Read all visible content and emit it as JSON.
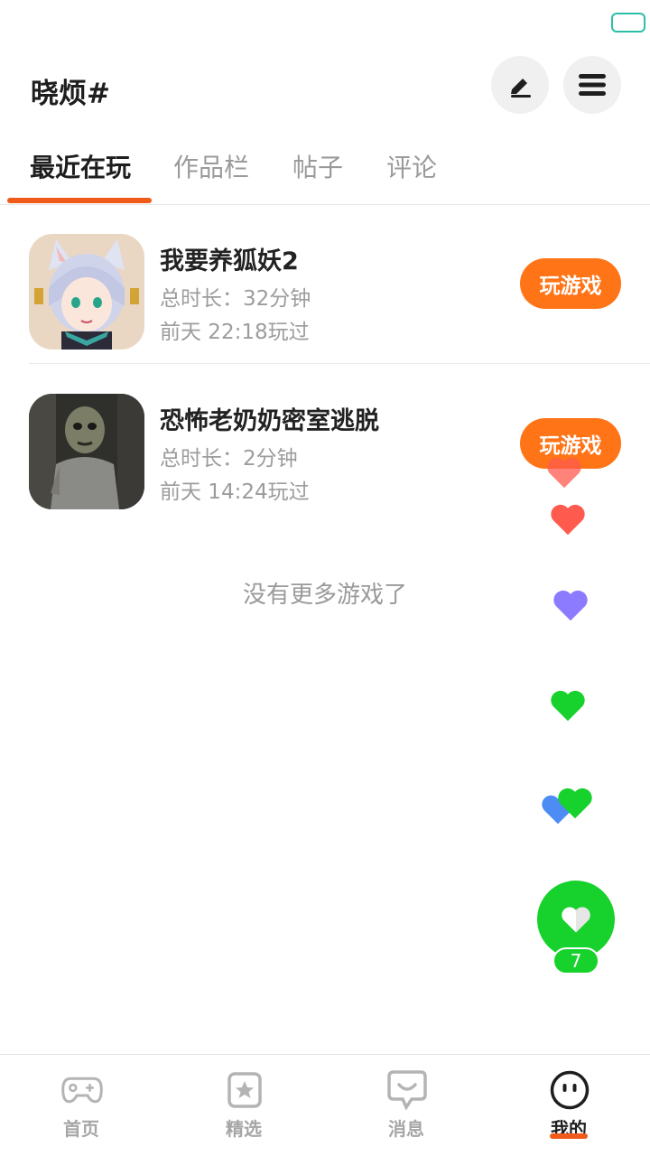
{
  "header": {
    "username": "晓烦#",
    "edit_icon": "pen-icon",
    "menu_icon": "hamburger-menu-icon"
  },
  "tabs": [
    {
      "label": "最近在玩",
      "active": true
    },
    {
      "label": "作品栏",
      "active": false
    },
    {
      "label": "帖子",
      "active": false
    },
    {
      "label": "评论",
      "active": false
    }
  ],
  "games": [
    {
      "name": "我要养狐妖2",
      "duration": "总时长：32分钟",
      "last_played": "前天 22:18玩过",
      "play_label": "玩游戏"
    },
    {
      "name": "恐怖老奶奶密室逃脱",
      "duration": "总时长：2分钟",
      "last_played": "前天 14:24玩过",
      "play_label": "玩游戏"
    }
  ],
  "list_end_text": "没有更多游戏了",
  "like": {
    "count": "7",
    "colors": {
      "red": "#ff5a4e",
      "purple": "#8c7bff",
      "green": "#17d12c",
      "blue": "#4d8cf5"
    }
  },
  "bottom_nav": [
    {
      "label": "首页",
      "icon": "gamepad-icon",
      "active": false
    },
    {
      "label": "精选",
      "icon": "star-bookmark-icon",
      "active": false
    },
    {
      "label": "消息",
      "icon": "chat-smile-icon",
      "active": false
    },
    {
      "label": "我的",
      "icon": "face-icon",
      "active": true
    }
  ],
  "colors": {
    "accent": "#ff7417",
    "tab_indicator": "#f05a1a"
  }
}
